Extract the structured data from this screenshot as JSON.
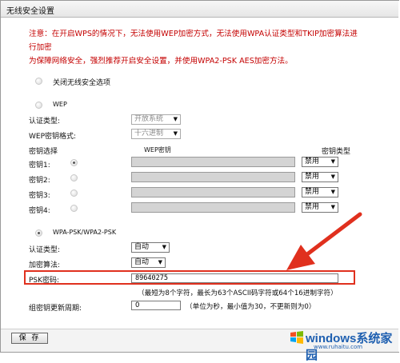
{
  "window": {
    "title": "无线安全设置"
  },
  "notice": {
    "line1": "注意：在开启WPS的情况下，无法使用WEP加密方式，无法使用WPA认证类型和TKIP加密算法进行加密",
    "line2": "为保障网络安全，强烈推荐开启安全设置，并使用WPA2-PSK AES加密方法。"
  },
  "options": {
    "disable_label": "关闭无线安全选项",
    "wep_label": "WEP",
    "wpa_label": "WPA-PSK/WPA2-PSK"
  },
  "wep": {
    "auth_label": "认证类型:",
    "auth_value": "开放系统",
    "format_label": "WEP密钥格式:",
    "format_value": "十六进制",
    "key_select_header": "密钥选择",
    "key_header": "WEP密钥",
    "key_type_header": "密钥类型",
    "keys": [
      {
        "label": "密钥1:",
        "type": "禁用"
      },
      {
        "label": "密钥2:",
        "type": "禁用"
      },
      {
        "label": "密钥3:",
        "type": "禁用"
      },
      {
        "label": "密钥4:",
        "type": "禁用"
      }
    ]
  },
  "wpa": {
    "auth_label": "认证类型:",
    "auth_value": "自动",
    "cipher_label": "加密算法:",
    "cipher_value": "自动",
    "psk_label": "PSK密码:",
    "psk_value": "89640275",
    "psk_hint": "（最短为8个字符，最长为63个ASCII码字符或64个16进制字符）",
    "group_key_label": "组密钥更新周期:",
    "group_key_value": "0",
    "group_key_hint": "（单位为秒，最小值为30，不更新则为0）"
  },
  "footer": {
    "save_label": "保 存"
  },
  "watermark": {
    "brand": "windows系统家园",
    "url": "www.ruhaitu.com"
  },
  "colors": {
    "notice": "#c40000",
    "highlight_box": "#e0301e",
    "arrow": "#e0301e",
    "watermark": "#1e5fb0"
  }
}
